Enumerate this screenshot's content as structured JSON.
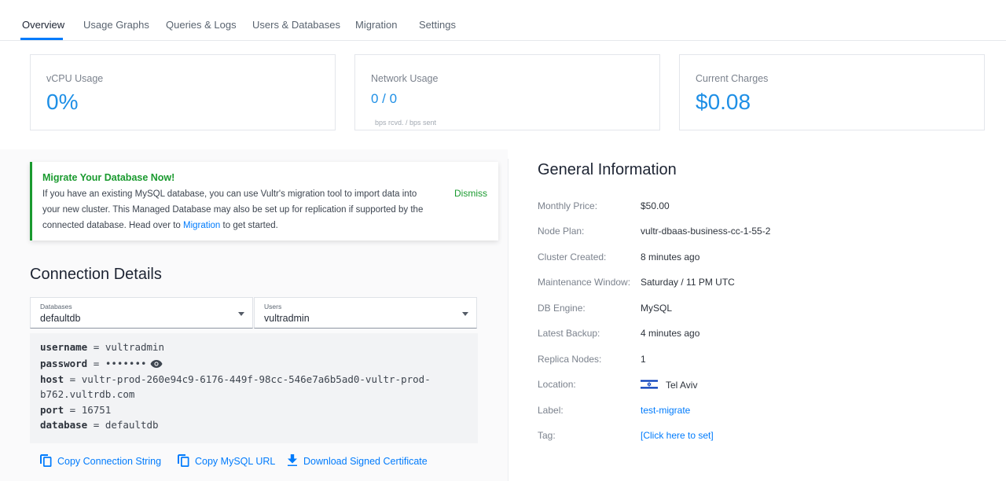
{
  "tabs": [
    {
      "label": "Overview"
    },
    {
      "label": "Usage Graphs"
    },
    {
      "label": "Queries & Logs"
    },
    {
      "label": "Users & Databases"
    },
    {
      "label": "Migration"
    },
    {
      "label": "Settings"
    }
  ],
  "cards": {
    "vcpu": {
      "title": "vCPU Usage",
      "value": "0%"
    },
    "network": {
      "title": "Network Usage",
      "value": "0 / 0",
      "sub": "bps rcvd. / bps sent"
    },
    "charges": {
      "title": "Current Charges",
      "value": "$0.08"
    }
  },
  "alert": {
    "title": "Migrate Your Database Now!",
    "text_before": "If you have an existing MySQL database, you can use Vultr's migration tool to import data into your new cluster. This Managed Database may also be set up for replication if supported by the connected database. Head over to",
    "link": "Migration",
    "text_after": "to get started.",
    "dismiss": "Dismiss"
  },
  "connection": {
    "title": "Connection Details",
    "databases": {
      "label": "Databases",
      "value": "defaultdb"
    },
    "users": {
      "label": "Users",
      "value": "vultradmin"
    },
    "code": {
      "username_key": "username",
      "username_val": "vultradmin",
      "password_key": "password",
      "password_val": "•••••••",
      "host_key": "host",
      "host_val_1": "vultr-prod-260e94c9-6176-449f-98cc-546e7a6b5ad0-vultr-prod-",
      "host_val_2": "b762.vultrdb.com",
      "port_key": "port",
      "port_val": "16751",
      "database_key": "database",
      "database_val": "defaultdb",
      "eq": "="
    },
    "actions": {
      "copy_string": "Copy Connection String",
      "copy_url": "Copy MySQL URL",
      "download_cert": "Download Signed Certificate"
    }
  },
  "general": {
    "title": "General Information",
    "rows": [
      {
        "label": "Monthly Price:",
        "value": "$50.00"
      },
      {
        "label": "Node Plan:",
        "value": "vultr-dbaas-business-cc-1-55-2"
      },
      {
        "label": "Cluster Created:",
        "value": "8 minutes ago"
      },
      {
        "label": "Maintenance Window:",
        "value": "Saturday / 11 PM UTC"
      },
      {
        "label": "DB Engine:",
        "value": "MySQL"
      },
      {
        "label": "Latest Backup:",
        "value": "4 minutes ago"
      },
      {
        "label": "Replica Nodes:",
        "value": "1"
      },
      {
        "label": "Location:",
        "value": "Tel Aviv"
      },
      {
        "label": "Label:",
        "value": "test-migrate"
      },
      {
        "label": "Tag:",
        "value": "[Click here to set]"
      }
    ]
  },
  "colors": {
    "accent": "#007bfc",
    "success": "#1a9a2f",
    "value": "#1e8fe6"
  }
}
